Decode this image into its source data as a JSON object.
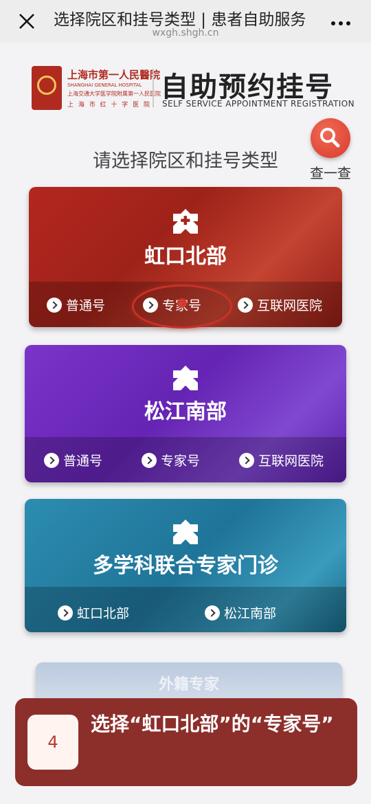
{
  "browser": {
    "title": "选择院区和挂号类型 | 患者自助服务",
    "url": "wxgh.shgh.cn"
  },
  "header": {
    "hospital_name": "上海市第一人民醫院",
    "hospital_en": "SHANGHAI GENERAL HOSPITAL",
    "hospital_sub1": "上海交通大学医学院附属第一人民医院",
    "hospital_sub2": "上 海 市 红 十 字 医 院",
    "title": "自助预约挂号",
    "title_en": "SELF SERVICE APPOINTMENT REGISTRATION"
  },
  "search": {
    "label": "查一查"
  },
  "page_subtitle": "请选择院区和挂号类型",
  "cards": [
    {
      "title": "虹口北部",
      "options": [
        "普通号",
        "专家号",
        "互联网医院"
      ]
    },
    {
      "title": "松江南部",
      "options": [
        "普通号",
        "专家号",
        "互联网医院"
      ]
    },
    {
      "title": "多学科联合专家门诊",
      "options": [
        "虹口北部",
        "松江南部"
      ]
    },
    {
      "title": "外籍专家"
    }
  ],
  "overlay": {
    "step": "4",
    "text": "选择“虹口北部”的“专家号”"
  },
  "colors": {
    "card1": "#b3271f",
    "card2": "#7a34c9",
    "card3": "#2c8db0",
    "overlay": "#8c2f2b"
  }
}
